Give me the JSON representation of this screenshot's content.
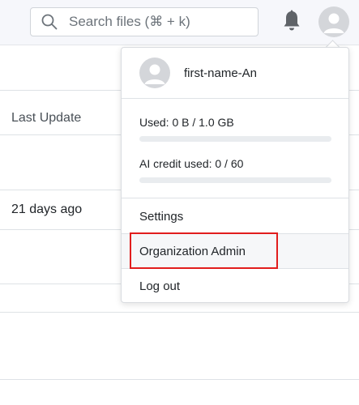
{
  "search": {
    "placeholder": "Search files (⌘ + k)"
  },
  "header": {
    "bell_icon": "bell-icon",
    "avatar_icon": "user-avatar-icon"
  },
  "table": {
    "column_header": "Last Update",
    "rows": [
      {
        "last_update": "21 days ago"
      }
    ]
  },
  "user_menu": {
    "user_name": "first-name-An",
    "storage": {
      "label": "Used: 0 B / 1.0 GB",
      "used_fraction": 0
    },
    "ai_credit": {
      "label": "AI credit used: 0 / 60",
      "used_fraction": 0
    },
    "items": [
      {
        "label": "Settings"
      },
      {
        "label": "Organization Admin",
        "highlighted": true
      },
      {
        "label": "Log out"
      }
    ]
  },
  "colors": {
    "highlight_box": "#e11d1d",
    "progress_fill": "#3b6fd6"
  }
}
